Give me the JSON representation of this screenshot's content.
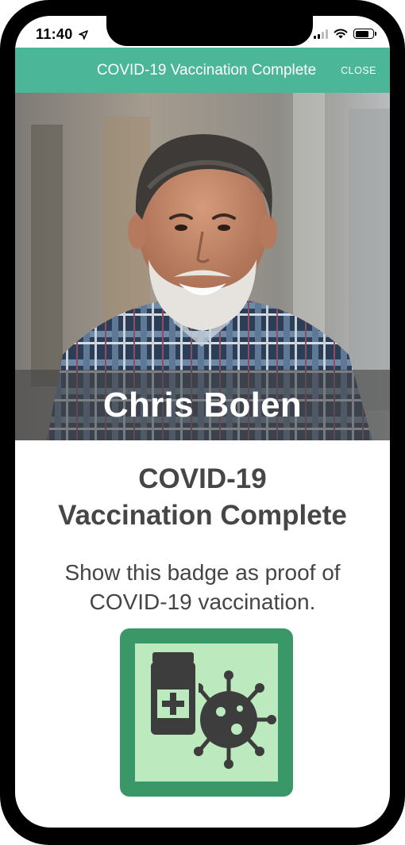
{
  "status_bar": {
    "time": "11:40"
  },
  "header": {
    "title": "COVID-19 Vaccination Complete",
    "close_label": "CLOSE"
  },
  "profile": {
    "name": "Chris Bolen"
  },
  "badge": {
    "title_line1": "COVID-19",
    "title_line2": "Vaccination Complete",
    "description": "Show this badge as proof of COVID-19 vaccination.",
    "icon": "vaccine-vial-virus-icon"
  },
  "colors": {
    "header_bg": "#4bb698",
    "badge_border": "#3a9868",
    "badge_fill": "#bce9be",
    "text_dark": "#464646"
  }
}
